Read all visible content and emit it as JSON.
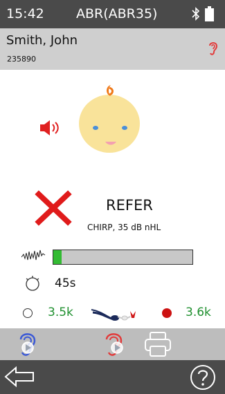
{
  "status_bar": {
    "time": "15:42",
    "title": "ABR(ABR35)",
    "bluetooth_icon": "bluetooth-icon",
    "battery_icon": "battery-icon"
  },
  "patient": {
    "name": "Smith, John",
    "id": "235890",
    "ear_icon": "right-ear-icon",
    "ear_color": "#e23a3a"
  },
  "test": {
    "stimulus_icon": "speaker-icon",
    "subject_icon": "baby-face-icon",
    "result_icon": "refer-cross-icon",
    "result": "REFER",
    "detail": "CHIRP,  35 dB nHL",
    "progress_fraction": 0.06,
    "progress_color": "#33bb33",
    "timer": "45s",
    "left_value": "3.5k",
    "right_value": "3.6k",
    "value_color": "#1e8f2e"
  },
  "actions": {
    "left_ear_play": "left-ear-play-icon",
    "right_ear_play": "right-ear-play-icon",
    "print": "printer-icon"
  },
  "nav": {
    "back": "back-arrow-icon",
    "help": "help-icon"
  }
}
